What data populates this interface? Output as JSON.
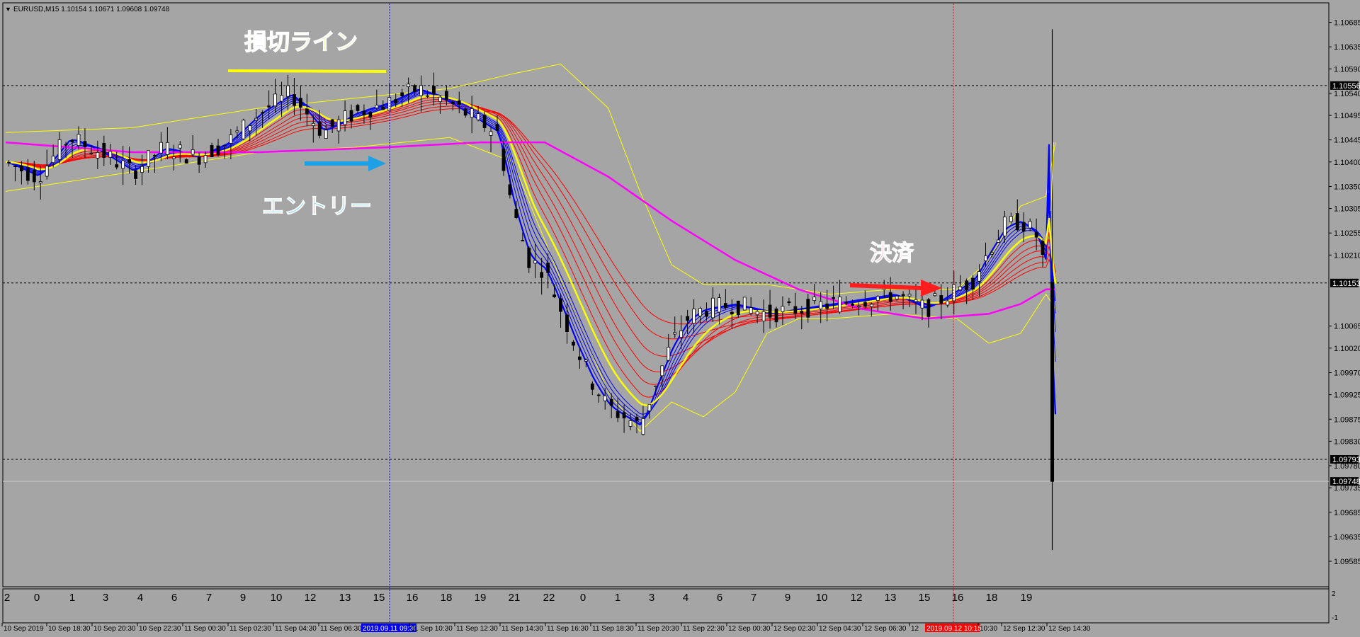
{
  "header": {
    "menu_glyph": "▼",
    "text": "EURUSD,M15  1.10154 1.10671 1.09608 1.09748"
  },
  "annotations": {
    "stop_loss_label": "損切ライン",
    "entry_label": "エントリー",
    "exit_label": "決済"
  },
  "colors": {
    "background": "#a5a5a5",
    "bollinger": "#ffff00",
    "ema_short": "#0000ff",
    "ema_long": "#ff0000",
    "ema_main_yellow": "#ffff00",
    "sma_slow": "#ff00ff",
    "stop_loss_text": "#c8f06a",
    "entry_text": "#1eb4ff",
    "exit_text": "#ff1e46",
    "entry_arrow": "#1ea0e6",
    "exit_arrow": "#ff1e1e",
    "vline_entry": "#0000ff",
    "vline_exit": "#ff0000"
  },
  "chart_data": {
    "type": "candlestick",
    "symbol": "EURUSD",
    "timeframe": "M15",
    "ohlc_header": {
      "open": 1.10154,
      "high": 1.10671,
      "low": 1.09608,
      "close": 1.09748
    },
    "ylim": [
      1.09585,
      1.1071
    ],
    "y_ticks": [
      1.10685,
      1.10635,
      1.1059,
      1.1054,
      1.10495,
      1.10445,
      1.104,
      1.1035,
      1.10305,
      1.10255,
      1.1021,
      1.10065,
      1.1002,
      1.0997,
      1.09925,
      1.09875,
      1.0983,
      1.0978,
      1.09735,
      1.09685,
      1.09635,
      1.09585
    ],
    "y_tick_labels": [
      "1.10685",
      "1.10635",
      "1.10590",
      "1.10540",
      "1.10495",
      "1.10445",
      "1.10400",
      "1.10350",
      "1.10305",
      "1.10255",
      "1.10210",
      "1.10065",
      "1.10020",
      "1.09970",
      "1.09925",
      "1.09875",
      "1.09830",
      "1.09780",
      "1.09735",
      "1.09685",
      "1.09635",
      "1.09585"
    ],
    "price_lines": [
      {
        "value": 1.10556,
        "label": "1.10556"
      },
      {
        "value": 1.10153,
        "label": "1.10153"
      },
      {
        "value": 1.09793,
        "label": "1.09793"
      }
    ],
    "current_price": {
      "value": 1.09748,
      "label": "1.09748"
    },
    "hour_labels": [
      "2",
      "0",
      "1",
      "3",
      "4",
      "6",
      "7",
      "9",
      "10",
      "12",
      "13",
      "15",
      "16",
      "18",
      "19",
      "21",
      "22",
      "0",
      "1",
      "3",
      "4",
      "6",
      "7",
      "9",
      "10",
      "12",
      "13",
      "15",
      "16",
      "18",
      "19"
    ],
    "time_labels": [
      "10 Sep 2019",
      "10 Sep 18:30",
      "10 Sep 20:30",
      "10 Sep 22:30",
      "11 Sep 00:30",
      "11 Sep 02:30",
      "11 Sep 04:30",
      "11 Sep 06:30",
      "2019.09.11 09:30",
      "11 Sep 10:30",
      "11 Sep 12:30",
      "11 Sep 14:30",
      "11 Sep 16:30",
      "11 Sep 18:30",
      "11 Sep 20:30",
      "11 Sep 22:30",
      "12 Sep 00:30",
      "12 Sep 02:30",
      "12 Sep 04:30",
      "12 Sep 06:30",
      "12",
      "2019.09.12 10:15",
      "10:30",
      "12 Sep 12:30",
      "12 Sep 14:30"
    ],
    "entry_time": "2019.09.11 09:30",
    "exit_time": "2019.09.12 10:15",
    "stop_loss_level": 1.1058,
    "entry_price": 1.1044,
    "exit_price": 1.1016,
    "price_path": [
      [
        0,
        1.104
      ],
      [
        10,
        1.1037
      ],
      [
        20,
        1.1045
      ],
      [
        30,
        1.1042
      ],
      [
        40,
        1.1038
      ],
      [
        50,
        1.1043
      ],
      [
        60,
        1.1041
      ],
      [
        70,
        1.1044
      ],
      [
        80,
        1.105
      ],
      [
        90,
        1.1054
      ],
      [
        100,
        1.1046
      ],
      [
        110,
        1.105
      ],
      [
        120,
        1.1052
      ],
      [
        130,
        1.1055
      ],
      [
        140,
        1.1052
      ],
      [
        150,
        1.1048
      ],
      [
        155,
        1.1046
      ],
      [
        160,
        1.103
      ],
      [
        165,
        1.102
      ],
      [
        170,
        1.1018
      ],
      [
        175,
        1.101
      ],
      [
        180,
        1.1002
      ],
      [
        185,
        1.0995
      ],
      [
        190,
        1.099
      ],
      [
        195,
        1.0988
      ],
      [
        200,
        1.0986
      ],
      [
        205,
        1.0995
      ],
      [
        210,
        1.1003
      ],
      [
        215,
        1.1008
      ],
      [
        220,
        1.101
      ],
      [
        230,
        1.1011
      ],
      [
        240,
        1.1009
      ],
      [
        250,
        1.101
      ],
      [
        260,
        1.1011
      ],
      [
        270,
        1.1012
      ],
      [
        280,
        1.1013
      ],
      [
        290,
        1.101
      ],
      [
        300,
        1.1014
      ],
      [
        305,
        1.1016
      ],
      [
        310,
        1.1022
      ],
      [
        315,
        1.1027
      ],
      [
        320,
        1.1028
      ],
      [
        325,
        1.1025
      ],
      [
        328,
        1.1018
      ],
      [
        329,
        1.10671
      ],
      [
        330,
        1.09608
      ],
      [
        331,
        1.09748
      ]
    ],
    "bollinger_upper": [
      [
        0,
        1.1046
      ],
      [
        40,
        1.1047
      ],
      [
        80,
        1.1051
      ],
      [
        110,
        1.1053
      ],
      [
        140,
        1.1055
      ],
      [
        160,
        1.1058
      ],
      [
        175,
        1.106
      ],
      [
        190,
        1.1051
      ],
      [
        200,
        1.1034
      ],
      [
        210,
        1.1019
      ],
      [
        220,
        1.1015
      ],
      [
        240,
        1.1015
      ],
      [
        260,
        1.1013
      ],
      [
        280,
        1.1014
      ],
      [
        300,
        1.1014
      ],
      [
        310,
        1.102
      ],
      [
        320,
        1.1031
      ],
      [
        328,
        1.1033
      ],
      [
        331,
        1.1044
      ]
    ],
    "bollinger_lower": [
      [
        0,
        1.1034
      ],
      [
        40,
        1.1038
      ],
      [
        80,
        1.1042
      ],
      [
        110,
        1.1043
      ],
      [
        140,
        1.1045
      ],
      [
        160,
        1.104
      ],
      [
        175,
        1.1016
      ],
      [
        190,
        1.0993
      ],
      [
        200,
        1.0985
      ],
      [
        210,
        1.0991
      ],
      [
        220,
        1.0988
      ],
      [
        230,
        1.0993
      ],
      [
        240,
        1.1005
      ],
      [
        250,
        1.1008
      ],
      [
        260,
        1.1008
      ],
      [
        280,
        1.1009
      ],
      [
        300,
        1.1008
      ],
      [
        310,
        1.1003
      ],
      [
        320,
        1.1005
      ],
      [
        328,
        1.1013
      ],
      [
        331,
        1.101
      ]
    ],
    "sma_slow": [
      [
        0,
        1.1044
      ],
      [
        40,
        1.1042
      ],
      [
        80,
        1.1042
      ],
      [
        120,
        1.1043
      ],
      [
        150,
        1.1044
      ],
      [
        170,
        1.1044
      ],
      [
        190,
        1.1037
      ],
      [
        210,
        1.1028
      ],
      [
        230,
        1.102
      ],
      [
        250,
        1.1014
      ],
      [
        270,
        1.101
      ],
      [
        290,
        1.1008
      ],
      [
        310,
        1.1009
      ],
      [
        320,
        1.1011
      ],
      [
        328,
        1.1014
      ],
      [
        331,
        1.1014
      ]
    ]
  }
}
